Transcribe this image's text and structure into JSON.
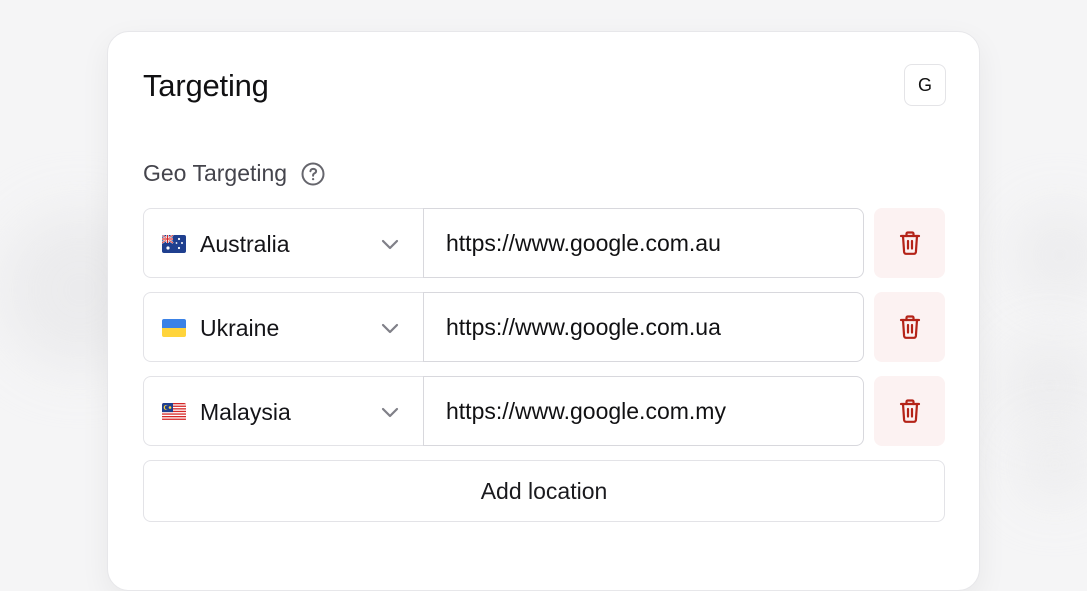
{
  "card": {
    "title": "Targeting",
    "g_button_label": "G"
  },
  "geo": {
    "label": "Geo Targeting",
    "rows": [
      {
        "country": "Australia",
        "flag": "australia-flag-icon",
        "url": "https://www.google.com.au"
      },
      {
        "country": "Ukraine",
        "flag": "ukraine-flag-icon",
        "url": "https://www.google.com.ua"
      },
      {
        "country": "Malaysia",
        "flag": "malaysia-flag-icon",
        "url": "https://www.google.com.my"
      }
    ],
    "add_label": "Add location"
  },
  "icons": {
    "help": "help-circle-icon",
    "chevron": "chevron-down-icon",
    "delete": "trash-icon"
  },
  "colors": {
    "delete_accent": "#b42318",
    "delete_bg": "#fcf2f2",
    "border": "#e3e3e7"
  }
}
